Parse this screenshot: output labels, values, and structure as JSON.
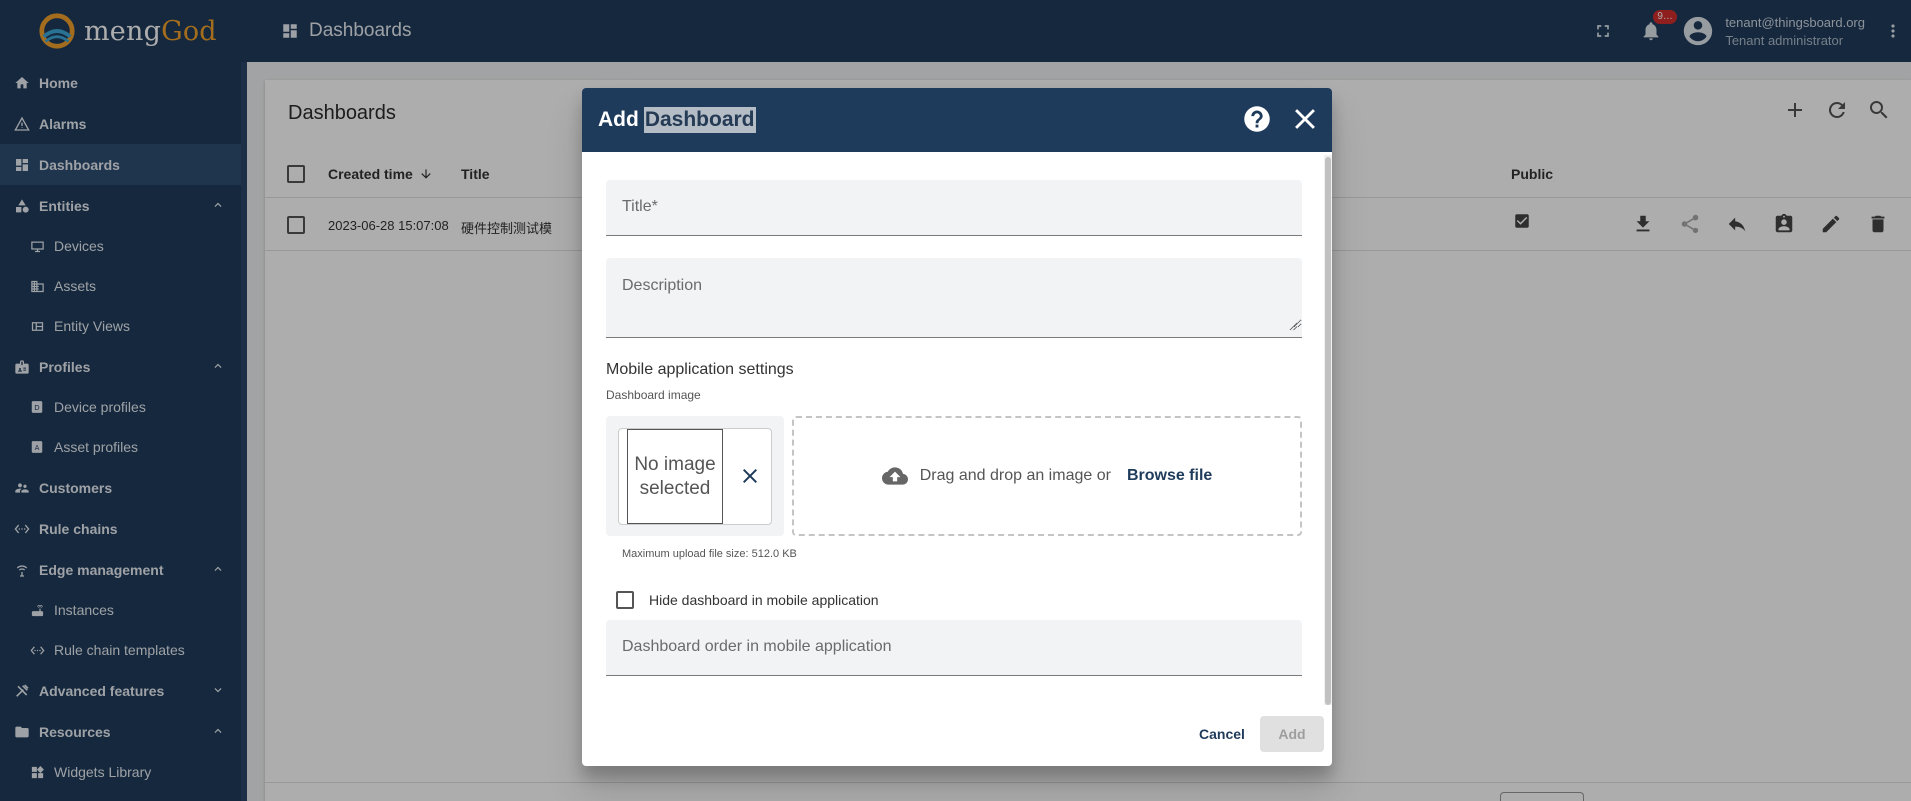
{
  "app": {
    "brand_prefix": "meng",
    "brand_suffix": "God"
  },
  "header": {
    "breadcrumb": "Dashboards",
    "notification_count": "9…",
    "user_email": "tenant@thingsboard.org",
    "user_role": "Tenant administrator"
  },
  "sidebar": {
    "items": [
      {
        "label": "Home"
      },
      {
        "label": "Alarms"
      },
      {
        "label": "Dashboards"
      },
      {
        "label": "Entities"
      },
      {
        "label": "Devices"
      },
      {
        "label": "Assets"
      },
      {
        "label": "Entity Views"
      },
      {
        "label": "Profiles"
      },
      {
        "label": "Device profiles"
      },
      {
        "label": "Asset profiles"
      },
      {
        "label": "Customers"
      },
      {
        "label": "Rule chains"
      },
      {
        "label": "Edge management"
      },
      {
        "label": "Instances"
      },
      {
        "label": "Rule chain templates"
      },
      {
        "label": "Advanced features"
      },
      {
        "label": "Resources"
      },
      {
        "label": "Widgets Library"
      }
    ]
  },
  "page": {
    "title": "Dashboards",
    "columns": {
      "created": "Created time",
      "title": "Title",
      "public": "Public"
    },
    "rows": [
      {
        "created": "2023-06-28 15:07:08",
        "title": "硬件控制测试模"
      }
    ]
  },
  "dialog": {
    "title_prefix": "Add",
    "title_selected": "Dashboard",
    "title_placeholder": "Title*",
    "description_placeholder": "Description",
    "mobile_section": "Mobile application settings",
    "image_label": "Dashboard image",
    "no_image_line1": "No image",
    "no_image_line2": "selected",
    "drop_text": "Drag and drop an image or",
    "browse": "Browse file",
    "max_size": "Maximum upload file size: 512.0 KB",
    "hide_label": "Hide dashboard in mobile application",
    "order_placeholder": "Dashboard order in mobile application",
    "cancel": "Cancel",
    "add": "Add"
  },
  "colors": {
    "primary": "#1f3b5b",
    "active_item": "#2f4e73",
    "logo_accent": "#f2a12b",
    "badge": "#d32f2f"
  }
}
